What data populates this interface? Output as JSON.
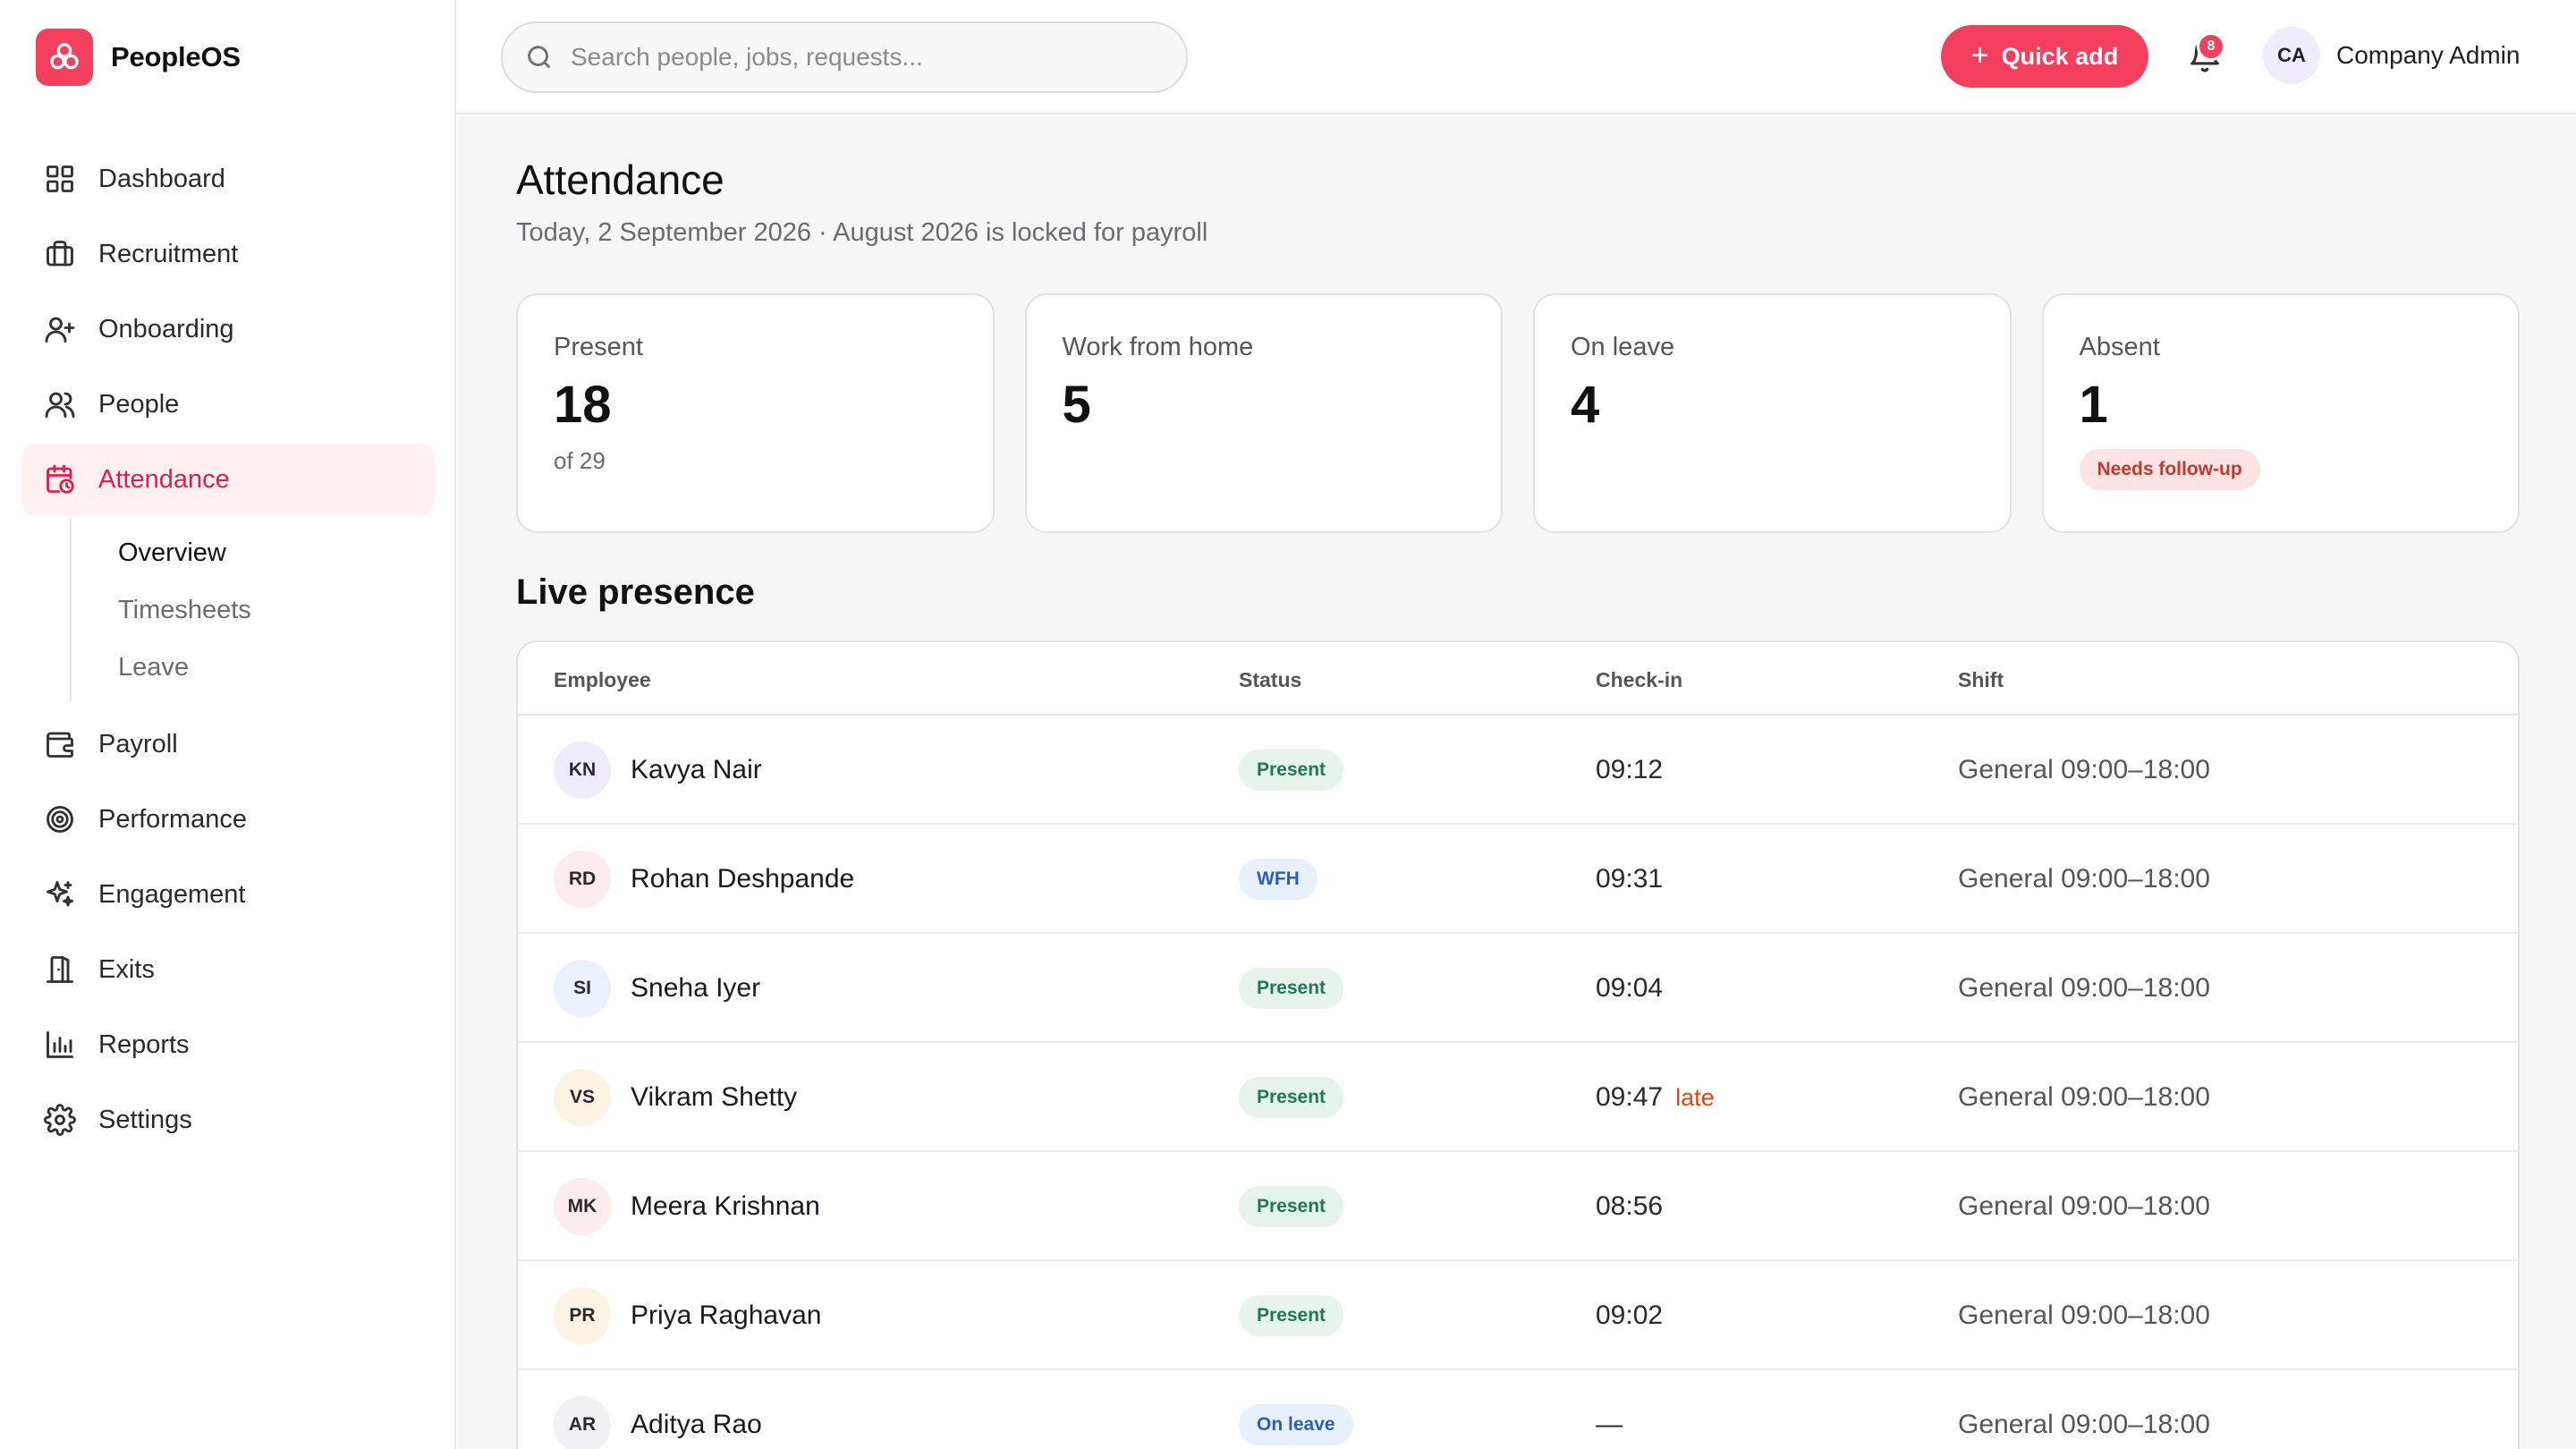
{
  "app": {
    "name": "PeopleOS",
    "accent": "#f43f5e"
  },
  "sidebar": {
    "items": [
      {
        "label": "Dashboard",
        "icon": "grid-icon"
      },
      {
        "label": "Recruitment",
        "icon": "briefcase-icon"
      },
      {
        "label": "Onboarding",
        "icon": "user-plus-icon"
      },
      {
        "label": "People",
        "icon": "users-icon"
      },
      {
        "label": "Attendance",
        "icon": "calendar-clock-icon",
        "active": true
      },
      {
        "label": "Payroll",
        "icon": "wallet-icon"
      },
      {
        "label": "Performance",
        "icon": "target-icon"
      },
      {
        "label": "Engagement",
        "icon": "sparkles-icon"
      },
      {
        "label": "Exits",
        "icon": "door-icon"
      },
      {
        "label": "Reports",
        "icon": "bar-chart-icon"
      },
      {
        "label": "Settings",
        "icon": "gear-icon"
      }
    ],
    "subitems": [
      {
        "label": "Overview",
        "current": true
      },
      {
        "label": "Timesheets"
      },
      {
        "label": "Leave"
      }
    ]
  },
  "topbar": {
    "search_placeholder": "Search people, jobs, requests...",
    "quick_add_label": "Quick add",
    "notification_count": "8",
    "user_initials": "CA",
    "user_name": "Company Admin"
  },
  "page": {
    "title": "Attendance",
    "subtitle": "Today, 2 September 2026 · August 2026 is locked for payroll",
    "section_title": "Live presence"
  },
  "stats": [
    {
      "label": "Present",
      "value": "18",
      "note": "of 29"
    },
    {
      "label": "Work from home",
      "value": "5"
    },
    {
      "label": "On leave",
      "value": "4"
    },
    {
      "label": "Absent",
      "value": "1",
      "pill": "Needs follow-up"
    }
  ],
  "table": {
    "columns": [
      "Employee",
      "Status",
      "Check-in",
      "Shift"
    ],
    "rows": [
      {
        "initials": "KN",
        "name": "Kavya Nair",
        "status": "Present",
        "checkin": "09:12",
        "late": "",
        "shift": "General 09:00–18:00",
        "avatar_bg": "#f1ecfb"
      },
      {
        "initials": "RD",
        "name": "Rohan Deshpande",
        "status": "WFH",
        "checkin": "09:31",
        "late": "",
        "shift": "General 09:00–18:00",
        "avatar_bg": "#fdecec"
      },
      {
        "initials": "SI",
        "name": "Sneha Iyer",
        "status": "Present",
        "checkin": "09:04",
        "late": "",
        "shift": "General 09:00–18:00",
        "avatar_bg": "#eaf1fb"
      },
      {
        "initials": "VS",
        "name": "Vikram Shetty",
        "status": "Present",
        "checkin": "09:47",
        "late": "late",
        "shift": "General 09:00–18:00",
        "avatar_bg": "#fdf3e3"
      },
      {
        "initials": "MK",
        "name": "Meera Krishnan",
        "status": "Present",
        "checkin": "08:56",
        "late": "",
        "shift": "General 09:00–18:00",
        "avatar_bg": "#fdecec"
      },
      {
        "initials": "PR",
        "name": "Priya Raghavan",
        "status": "Present",
        "checkin": "09:02",
        "late": "",
        "shift": "General 09:00–18:00",
        "avatar_bg": "#fdf3e3"
      },
      {
        "initials": "AR",
        "name": "Aditya Rao",
        "status": "On leave",
        "checkin": "—",
        "late": "",
        "shift": "General 09:00–18:00",
        "avatar_bg": "#f1f1f3"
      }
    ]
  },
  "status_colors": {
    "Present": {
      "bg": "#e6f4ec",
      "fg": "#1f7a4d"
    },
    "WFH": {
      "bg": "#e8f0fc",
      "fg": "#2b5fb3"
    },
    "On leave": {
      "bg": "#e8f0fc",
      "fg": "#2b5fb3"
    }
  }
}
